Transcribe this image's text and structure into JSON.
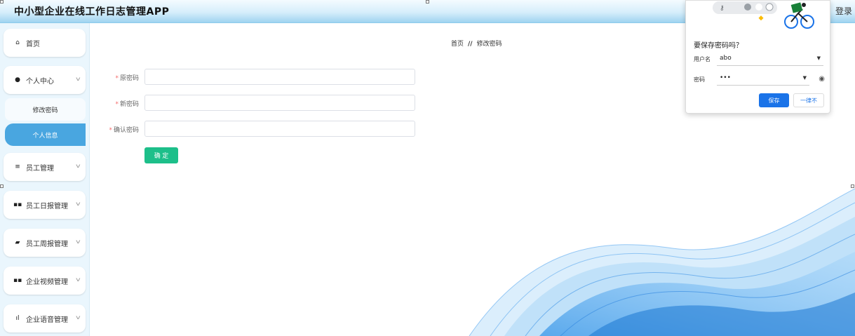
{
  "header": {
    "title": "中小型企业在线工作日志管理APP",
    "logout_label": "登录"
  },
  "sidebar": {
    "items": [
      {
        "label": "首页",
        "icon": "home-icon"
      },
      {
        "label": "个人中心",
        "icon": "user-icon"
      },
      {
        "label": "员工管理",
        "icon": "sliders-icon"
      },
      {
        "label": "员工日报管理",
        "icon": "grid-icon"
      },
      {
        "label": "员工周报管理",
        "icon": "thumb-icon"
      },
      {
        "label": "企业视频管理",
        "icon": "grid-icon"
      },
      {
        "label": "企业语音管理",
        "icon": "bar-chart-icon"
      }
    ],
    "subitems": [
      {
        "label": "修改密码"
      },
      {
        "label": "个人信息",
        "active": true
      }
    ]
  },
  "breadcrumb": {
    "home": "首页",
    "separator": "//",
    "current": "修改密码"
  },
  "form": {
    "fields": [
      {
        "label": "原密码",
        "value": ""
      },
      {
        "label": "新密码",
        "value": ""
      },
      {
        "label": "确认密码",
        "value": ""
      }
    ],
    "submit_label": "确 定"
  },
  "password_popup": {
    "title": "要保存密码吗？",
    "username_label": "用户名",
    "username_value": "abo",
    "password_label": "密码",
    "password_value": "•••",
    "save_label": "保存",
    "never_label": "一律不"
  },
  "colors": {
    "accent": "#49a6e0",
    "confirm": "#1dbf8a",
    "popup_button": "#1a73e8"
  }
}
